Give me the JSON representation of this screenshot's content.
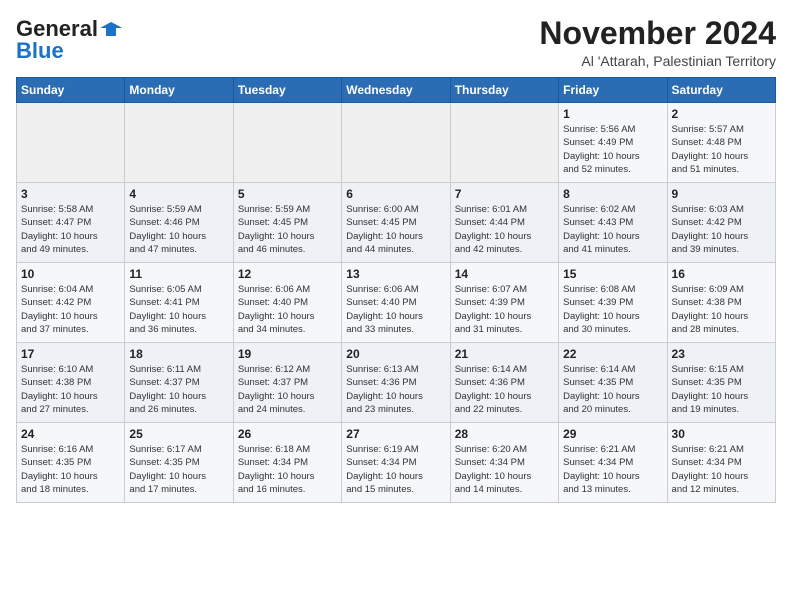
{
  "header": {
    "logo_general": "General",
    "logo_blue": "Blue",
    "title": "November 2024",
    "subtitle": "Al 'Attarah, Palestinian Territory"
  },
  "weekdays": [
    "Sunday",
    "Monday",
    "Tuesday",
    "Wednesday",
    "Thursday",
    "Friday",
    "Saturday"
  ],
  "weeks": [
    [
      {
        "day": "",
        "info": ""
      },
      {
        "day": "",
        "info": ""
      },
      {
        "day": "",
        "info": ""
      },
      {
        "day": "",
        "info": ""
      },
      {
        "day": "",
        "info": ""
      },
      {
        "day": "1",
        "info": "Sunrise: 5:56 AM\nSunset: 4:49 PM\nDaylight: 10 hours\nand 52 minutes."
      },
      {
        "day": "2",
        "info": "Sunrise: 5:57 AM\nSunset: 4:48 PM\nDaylight: 10 hours\nand 51 minutes."
      }
    ],
    [
      {
        "day": "3",
        "info": "Sunrise: 5:58 AM\nSunset: 4:47 PM\nDaylight: 10 hours\nand 49 minutes."
      },
      {
        "day": "4",
        "info": "Sunrise: 5:59 AM\nSunset: 4:46 PM\nDaylight: 10 hours\nand 47 minutes."
      },
      {
        "day": "5",
        "info": "Sunrise: 5:59 AM\nSunset: 4:45 PM\nDaylight: 10 hours\nand 46 minutes."
      },
      {
        "day": "6",
        "info": "Sunrise: 6:00 AM\nSunset: 4:45 PM\nDaylight: 10 hours\nand 44 minutes."
      },
      {
        "day": "7",
        "info": "Sunrise: 6:01 AM\nSunset: 4:44 PM\nDaylight: 10 hours\nand 42 minutes."
      },
      {
        "day": "8",
        "info": "Sunrise: 6:02 AM\nSunset: 4:43 PM\nDaylight: 10 hours\nand 41 minutes."
      },
      {
        "day": "9",
        "info": "Sunrise: 6:03 AM\nSunset: 4:42 PM\nDaylight: 10 hours\nand 39 minutes."
      }
    ],
    [
      {
        "day": "10",
        "info": "Sunrise: 6:04 AM\nSunset: 4:42 PM\nDaylight: 10 hours\nand 37 minutes."
      },
      {
        "day": "11",
        "info": "Sunrise: 6:05 AM\nSunset: 4:41 PM\nDaylight: 10 hours\nand 36 minutes."
      },
      {
        "day": "12",
        "info": "Sunrise: 6:06 AM\nSunset: 4:40 PM\nDaylight: 10 hours\nand 34 minutes."
      },
      {
        "day": "13",
        "info": "Sunrise: 6:06 AM\nSunset: 4:40 PM\nDaylight: 10 hours\nand 33 minutes."
      },
      {
        "day": "14",
        "info": "Sunrise: 6:07 AM\nSunset: 4:39 PM\nDaylight: 10 hours\nand 31 minutes."
      },
      {
        "day": "15",
        "info": "Sunrise: 6:08 AM\nSunset: 4:39 PM\nDaylight: 10 hours\nand 30 minutes."
      },
      {
        "day": "16",
        "info": "Sunrise: 6:09 AM\nSunset: 4:38 PM\nDaylight: 10 hours\nand 28 minutes."
      }
    ],
    [
      {
        "day": "17",
        "info": "Sunrise: 6:10 AM\nSunset: 4:38 PM\nDaylight: 10 hours\nand 27 minutes."
      },
      {
        "day": "18",
        "info": "Sunrise: 6:11 AM\nSunset: 4:37 PM\nDaylight: 10 hours\nand 26 minutes."
      },
      {
        "day": "19",
        "info": "Sunrise: 6:12 AM\nSunset: 4:37 PM\nDaylight: 10 hours\nand 24 minutes."
      },
      {
        "day": "20",
        "info": "Sunrise: 6:13 AM\nSunset: 4:36 PM\nDaylight: 10 hours\nand 23 minutes."
      },
      {
        "day": "21",
        "info": "Sunrise: 6:14 AM\nSunset: 4:36 PM\nDaylight: 10 hours\nand 22 minutes."
      },
      {
        "day": "22",
        "info": "Sunrise: 6:14 AM\nSunset: 4:35 PM\nDaylight: 10 hours\nand 20 minutes."
      },
      {
        "day": "23",
        "info": "Sunrise: 6:15 AM\nSunset: 4:35 PM\nDaylight: 10 hours\nand 19 minutes."
      }
    ],
    [
      {
        "day": "24",
        "info": "Sunrise: 6:16 AM\nSunset: 4:35 PM\nDaylight: 10 hours\nand 18 minutes."
      },
      {
        "day": "25",
        "info": "Sunrise: 6:17 AM\nSunset: 4:35 PM\nDaylight: 10 hours\nand 17 minutes."
      },
      {
        "day": "26",
        "info": "Sunrise: 6:18 AM\nSunset: 4:34 PM\nDaylight: 10 hours\nand 16 minutes."
      },
      {
        "day": "27",
        "info": "Sunrise: 6:19 AM\nSunset: 4:34 PM\nDaylight: 10 hours\nand 15 minutes."
      },
      {
        "day": "28",
        "info": "Sunrise: 6:20 AM\nSunset: 4:34 PM\nDaylight: 10 hours\nand 14 minutes."
      },
      {
        "day": "29",
        "info": "Sunrise: 6:21 AM\nSunset: 4:34 PM\nDaylight: 10 hours\nand 13 minutes."
      },
      {
        "day": "30",
        "info": "Sunrise: 6:21 AM\nSunset: 4:34 PM\nDaylight: 10 hours\nand 12 minutes."
      }
    ]
  ]
}
